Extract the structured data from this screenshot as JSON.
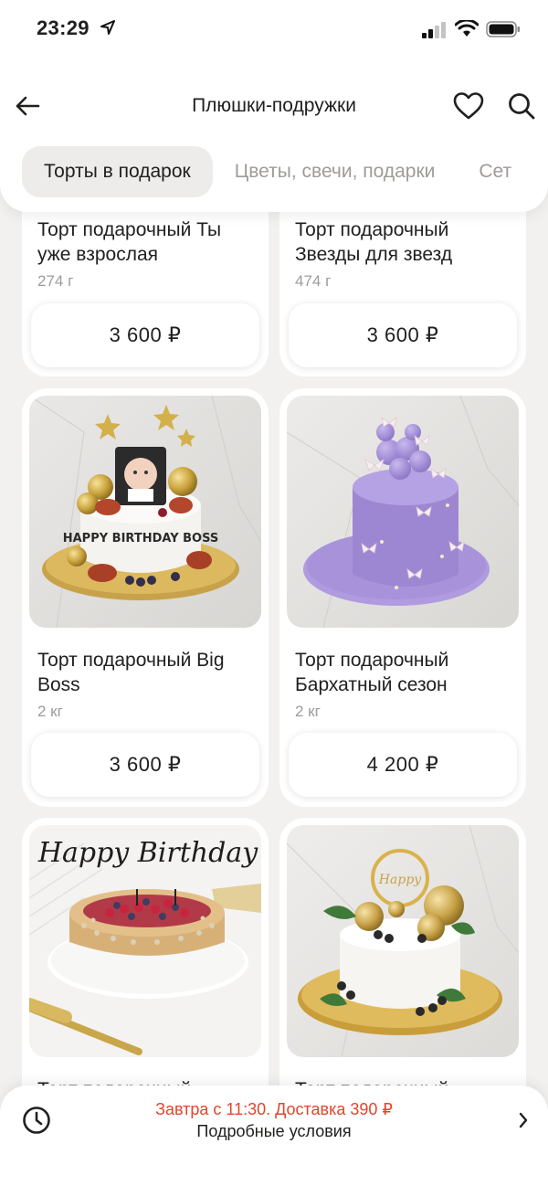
{
  "status": {
    "time": "23:29"
  },
  "header": {
    "title": "Плюшки-подружки"
  },
  "tabs": [
    {
      "label": "Торты в подарок",
      "active": true
    },
    {
      "label": "Цветы, свечи, подарки",
      "active": false
    },
    {
      "label": "Сет",
      "active": false
    }
  ],
  "products": [
    {
      "name": "Торт подарочный Ты уже взрослая",
      "weight": "274 г",
      "price": "3 600 ₽"
    },
    {
      "name": "Торт подарочный Звезды для звезд",
      "weight": "474 г",
      "price": "3 600 ₽"
    },
    {
      "name": "Торт подарочный Big Boss",
      "weight": "2 кг",
      "price": "3 600 ₽",
      "cake_topper": "HAPPY BIRTHDAY BOSS"
    },
    {
      "name": "Торт подарочный Бархатный сезон",
      "weight": "2 кг",
      "price": "4 200 ₽"
    },
    {
      "name": "Торт подарочный",
      "cake_topper": "Happy Birthday"
    },
    {
      "name": "Торт подарочный"
    }
  ],
  "delivery": {
    "main": "Завтра с 11:30. Доставка 390 ₽",
    "sub": "Подробные условия"
  },
  "colors": {
    "accent": "#e0452c",
    "background": "#f2f1ef",
    "tab_active": "#edecea",
    "muted_text": "#9e9b98"
  },
  "icons": [
    "arrow-left-icon",
    "heart-icon",
    "search-icon",
    "clock-icon",
    "chevron-right-icon",
    "location-arrow-icon",
    "signal-icon",
    "wifi-icon",
    "battery-icon"
  ]
}
